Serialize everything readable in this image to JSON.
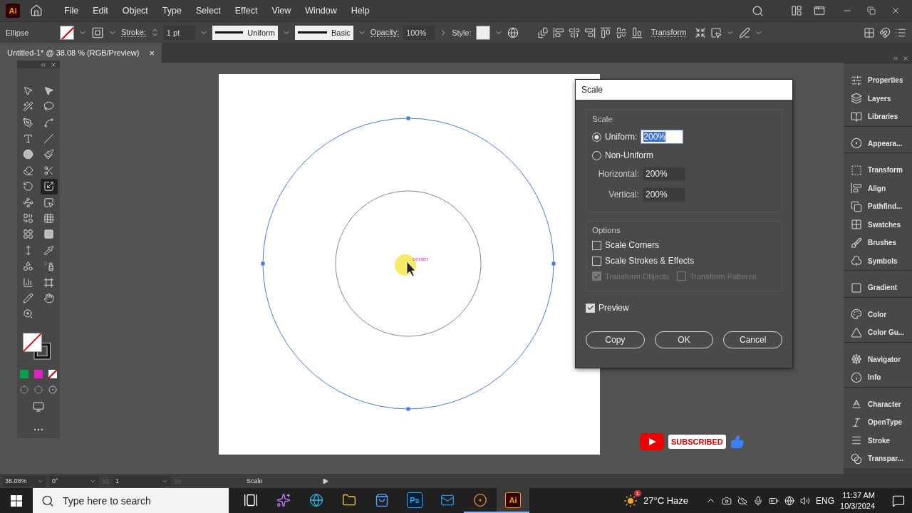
{
  "app": {
    "logo": "Ai"
  },
  "menu": [
    "File",
    "Edit",
    "Object",
    "Type",
    "Select",
    "Effect",
    "View",
    "Window",
    "Help"
  ],
  "control_bar": {
    "selection": "Ellipse",
    "stroke_label": "Stroke:",
    "stroke_weight": "1 pt",
    "profile": "Uniform",
    "brush": "Basic",
    "opacity_label": "Opacity:",
    "opacity": "100%",
    "style_label": "Style:",
    "transform": "Transform"
  },
  "document_tab": {
    "title": "Untitled-1* @ 38.08 % (RGB/Preview)",
    "close": "×"
  },
  "tools": [
    {
      "kind": "selection",
      "selected": false
    },
    {
      "kind": "direct",
      "selected": false
    },
    {
      "kind": "wand",
      "selected": false
    },
    {
      "kind": "lasso",
      "selected": false
    },
    {
      "kind": "pen",
      "selected": false
    },
    {
      "kind": "curvature",
      "selected": false
    },
    {
      "kind": "type",
      "selected": false
    },
    {
      "kind": "line",
      "selected": false
    },
    {
      "kind": "ellipse",
      "selected": false
    },
    {
      "kind": "paintbrush",
      "selected": false
    },
    {
      "kind": "shaper",
      "selected": false
    },
    {
      "kind": "scissors",
      "selected": false
    },
    {
      "kind": "rotate",
      "selected": false
    },
    {
      "kind": "scale",
      "selected": true
    },
    {
      "kind": "warp",
      "selected": false
    },
    {
      "kind": "freetransform",
      "selected": false
    },
    {
      "kind": "shapebuilder",
      "selected": false
    },
    {
      "kind": "perspective",
      "selected": false
    },
    {
      "kind": "mesh",
      "selected": false
    },
    {
      "kind": "gradient",
      "selected": false
    },
    {
      "kind": "width",
      "selected": false
    },
    {
      "kind": "eyedropper",
      "selected": false
    },
    {
      "kind": "blend",
      "selected": false
    },
    {
      "kind": "sprayer",
      "selected": false
    },
    {
      "kind": "graph",
      "selected": false
    },
    {
      "kind": "artboard",
      "selected": false
    },
    {
      "kind": "pencil",
      "selected": false
    },
    {
      "kind": "hand",
      "selected": false
    },
    {
      "kind": "zoom",
      "selected": false
    }
  ],
  "canvas": {
    "smart_guide": "center"
  },
  "scale_dialog": {
    "title": "Scale",
    "scale_section": {
      "title": "Scale",
      "options": [
        {
          "label": "Uniform:",
          "selected": true,
          "value": "200%"
        },
        {
          "label": "Non-Uniform",
          "selected": false
        }
      ],
      "fields": [
        {
          "label": "Horizontal:",
          "value": "200%"
        },
        {
          "label": "Vertical:",
          "value": "200%"
        }
      ]
    },
    "options_section": {
      "title": "Options",
      "checkboxes": [
        {
          "label": "Scale Corners",
          "checked": false,
          "disabled": false
        },
        {
          "label": "Scale Strokes & Effects",
          "checked": false,
          "disabled": false
        }
      ],
      "transform_checkboxes": [
        {
          "label": "Transform Objects",
          "checked": true,
          "disabled": true
        },
        {
          "label": "Transform Patterns",
          "checked": false,
          "disabled": true
        }
      ]
    },
    "preview": {
      "label": "Preview",
      "checked": true
    },
    "buttons": [
      "Copy",
      "OK",
      "Cancel"
    ]
  },
  "subscribe_overlay": {
    "label": "SUBSCRIBED"
  },
  "panels": [
    [
      {
        "kind": "properties",
        "label": "Properties"
      },
      {
        "kind": "layers",
        "label": "Layers"
      },
      {
        "kind": "libraries",
        "label": "Libraries"
      }
    ],
    [
      {
        "kind": "appearance",
        "label": "Appeara..."
      }
    ],
    [
      {
        "kind": "transform",
        "label": "Transform"
      },
      {
        "kind": "align",
        "label": "Align"
      },
      {
        "kind": "pathfinder",
        "label": "Pathfind..."
      },
      {
        "kind": "swatches",
        "label": "Swatches"
      },
      {
        "kind": "brushes",
        "label": "Brushes"
      },
      {
        "kind": "symbols",
        "label": "Symbols"
      }
    ],
    [
      {
        "kind": "gradient",
        "label": "Gradient"
      }
    ],
    [
      {
        "kind": "color",
        "label": "Color"
      },
      {
        "kind": "guide",
        "label": "Color Gu..."
      }
    ],
    [
      {
        "kind": "navigator",
        "label": "Navigator"
      },
      {
        "kind": "info",
        "label": "Info"
      }
    ],
    [
      {
        "kind": "character",
        "label": "Character"
      },
      {
        "kind": "opentype",
        "label": "OpenType"
      },
      {
        "kind": "stroke",
        "label": "Stroke"
      },
      {
        "kind": "transparency",
        "label": "Transpar..."
      }
    ]
  ],
  "status_bar": {
    "zoom": "38.08%",
    "rotation": "0°",
    "artboard": "1",
    "tool": "Scale"
  },
  "taskbar": {
    "search_placeholder": "Type here to search",
    "apps": [
      {
        "kind": "taskview",
        "running": false,
        "selected": false
      },
      {
        "kind": "copilot",
        "running": false,
        "selected": false
      },
      {
        "kind": "edge",
        "running": false,
        "selected": false
      },
      {
        "kind": "explorer",
        "running": false,
        "selected": false
      },
      {
        "kind": "store",
        "running": false,
        "selected": false
      },
      {
        "kind": "photoshop",
        "label": "Ps",
        "running": false,
        "selected": false
      },
      {
        "kind": "mail",
        "running": false,
        "selected": false
      },
      {
        "kind": "recorder",
        "running": true,
        "selected": false
      },
      {
        "kind": "illustrator",
        "label": "Ai",
        "running": true,
        "selected": true
      }
    ],
    "weather_badge": "1",
    "weather": "27°C Haze",
    "language": "ENG",
    "time": "11:37 AM",
    "date": "10/3/2024"
  }
}
